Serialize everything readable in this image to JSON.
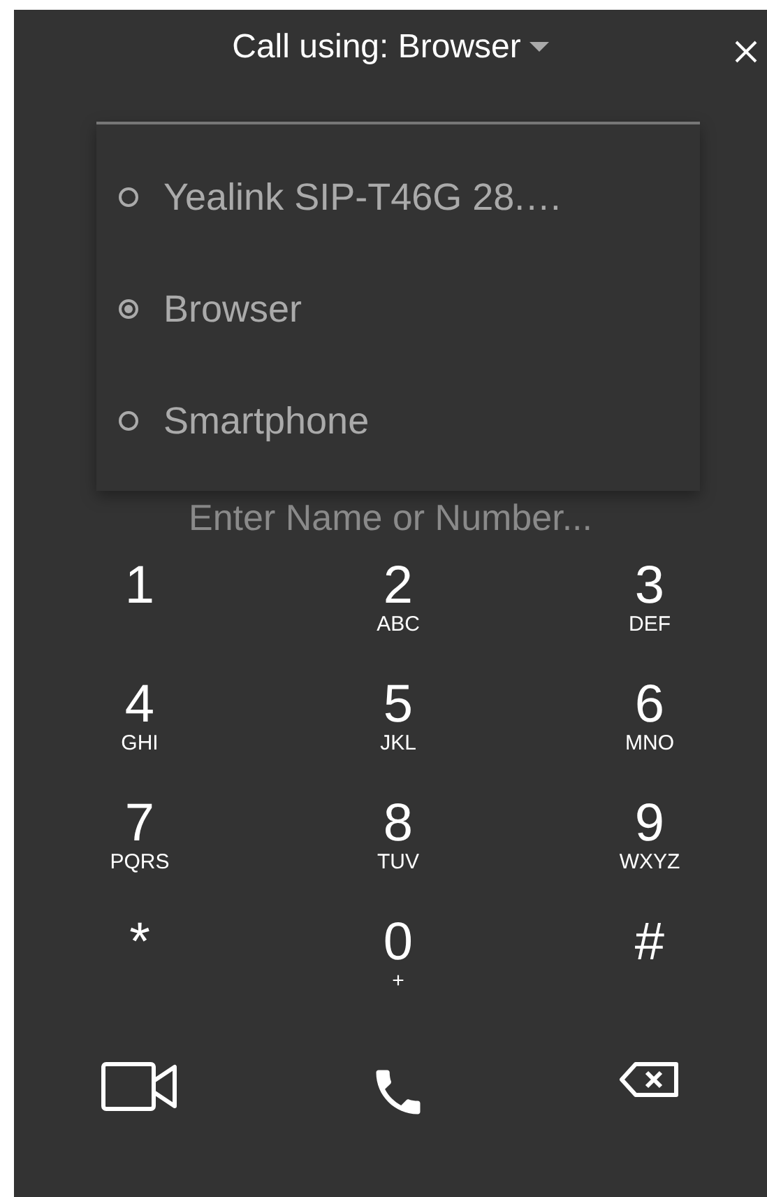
{
  "header": {
    "title": "Call using: Browser"
  },
  "call_options": [
    {
      "label": "Yealink SIP-T46G 28.…",
      "selected": false
    },
    {
      "label": "Browser",
      "selected": true
    },
    {
      "label": "Smartphone",
      "selected": false
    }
  ],
  "number_field": {
    "placeholder": "Enter Name or Number..."
  },
  "keypad": [
    {
      "digit": "1"
    },
    {
      "digit": "2",
      "letters": "ABC"
    },
    {
      "digit": "3",
      "letters": "DEF"
    },
    {
      "digit": "4",
      "letters": "GHI"
    },
    {
      "digit": "5",
      "letters": "JKL"
    },
    {
      "digit": "6",
      "letters": "MNO"
    },
    {
      "digit": "7",
      "letters": "PQRS"
    },
    {
      "digit": "8",
      "letters": "TUV"
    },
    {
      "digit": "9",
      "letters": "WXYZ"
    },
    {
      "digit": "*"
    },
    {
      "digit": "0",
      "letters": "+"
    },
    {
      "digit": "#"
    }
  ]
}
